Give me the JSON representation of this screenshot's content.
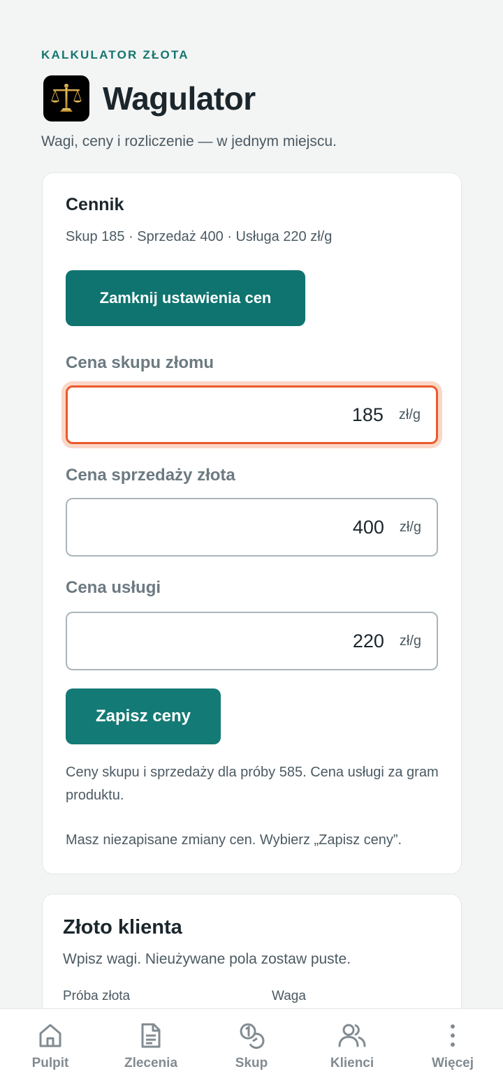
{
  "header": {
    "eyebrow": "KALKULATOR ZŁOTA",
    "app_title": "Wagulator",
    "tagline": "Wagi, ceny i rozliczenie — w jednym miejscu.",
    "logo_icon": "golden-scales-icon"
  },
  "pricing": {
    "title": "Cennik",
    "summary": "Skup 185 · Sprzedaż 400 · Usługa 220 zł/g",
    "close_settings_label": "Zamknij ustawienia cen",
    "fields": [
      {
        "label": "Cena skupu złomu",
        "value": "185",
        "unit": "zł/g",
        "focused": true
      },
      {
        "label": "Cena sprzedaży złota",
        "value": "400",
        "unit": "zł/g",
        "focused": false
      },
      {
        "label": "Cena usługi",
        "value": "220",
        "unit": "zł/g",
        "focused": false
      }
    ],
    "save_label": "Zapisz ceny",
    "info_note": "Ceny skupu i sprzedaży dla próby 585. Cena usługi za gram produktu.",
    "unsaved_note": "Masz niezapisane zmiany cen. Wybierz „Zapisz ceny”."
  },
  "client_gold": {
    "title": "Złoto klienta",
    "subtitle": "Wpisz wagi. Nieużywane pola zostaw puste.",
    "col_purity": "Próba złota",
    "col_weight": "Waga"
  },
  "nav": {
    "items": [
      {
        "label": "Pulpit",
        "icon": "home-icon"
      },
      {
        "label": "Zlecenia",
        "icon": "document-icon"
      },
      {
        "label": "Skup",
        "icon": "coins-icon"
      },
      {
        "label": "Klienci",
        "icon": "users-icon"
      },
      {
        "label": "Więcej",
        "icon": "more-vertical-icon"
      }
    ]
  },
  "colors": {
    "accent": "#0f7470",
    "focus_ring": "#ea5a2a",
    "background": "#f3f4f4"
  }
}
